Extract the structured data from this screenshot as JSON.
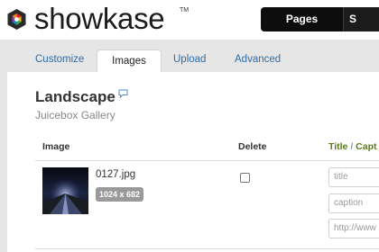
{
  "app": {
    "brand": "showkase",
    "trademark": "TM"
  },
  "topnav": {
    "active": "Pages",
    "next_partial": "S"
  },
  "tabs": {
    "customize": "Customize",
    "images": "Images",
    "upload": "Upload",
    "advanced": "Advanced",
    "active": "Images"
  },
  "page": {
    "title": "Landscape",
    "subtitle": "Juicebox Gallery"
  },
  "table": {
    "headers": {
      "image": "Image",
      "delete": "Delete",
      "title": "Title",
      "slash": " / ",
      "caption": "Capt"
    },
    "rows": [
      {
        "filename": "0127.jpg",
        "dimensions": "1024 x 682",
        "delete_checked": false,
        "title_placeholder": "title",
        "caption_placeholder": "caption",
        "link_placeholder": "http://www"
      }
    ]
  },
  "colors": {
    "accent_link": "#2f6da3",
    "header_green": "#5a7a1e",
    "nav_dark": "#0d0d0d",
    "tab_background": "#e6e6e6"
  },
  "icons": {
    "logo": "showkase-hexagon-logo",
    "speech": "speech-bubble-icon"
  }
}
